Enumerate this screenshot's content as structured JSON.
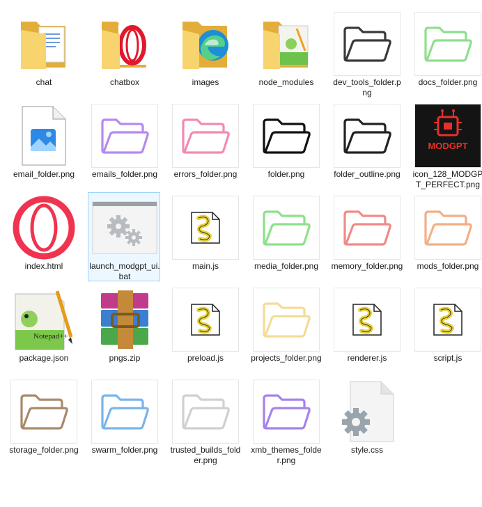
{
  "items": [
    {
      "label": "chat",
      "icon": "explorer-folder-document-icon",
      "kind": "folder-doc"
    },
    {
      "label": "chatbox",
      "icon": "explorer-folder-opera-icon",
      "kind": "folder-opera"
    },
    {
      "label": "images",
      "icon": "explorer-folder-edge-icon",
      "kind": "folder-edge"
    },
    {
      "label": "node_modules",
      "icon": "explorer-folder-notepadpp-icon",
      "kind": "folder-npp"
    },
    {
      "label": "dev_tools_folder.png",
      "icon": "folder-outline-icon",
      "kind": "png-folder",
      "color": "#3a3a3a"
    },
    {
      "label": "docs_folder.png",
      "icon": "folder-outline-icon",
      "kind": "png-folder",
      "color": "#8ee08a"
    },
    {
      "label": "email_folder.png",
      "icon": "image-file-icon",
      "kind": "image-file"
    },
    {
      "label": "emails_folder.png",
      "icon": "folder-outline-icon",
      "kind": "png-folder",
      "color": "#b48af0"
    },
    {
      "label": "errors_folder.png",
      "icon": "folder-outline-icon",
      "kind": "png-folder",
      "color": "#f28ab4"
    },
    {
      "label": "folder.png",
      "icon": "folder-outline-icon",
      "kind": "png-folder",
      "color": "#111111"
    },
    {
      "label": "folder_outline.png",
      "icon": "folder-outline-icon",
      "kind": "png-folder",
      "color": "#222222"
    },
    {
      "label": "icon_128_MODGPT_PERFECT.png",
      "icon": "modgpt-chip-icon",
      "kind": "modgpt",
      "text": "MODGPT"
    },
    {
      "label": "index.html",
      "icon": "opera-logo-icon",
      "kind": "opera"
    },
    {
      "label": "launch_modgpt_ui.bat",
      "icon": "batch-gears-icon",
      "kind": "bat",
      "selected": true
    },
    {
      "label": "main.js",
      "icon": "js-script-file-icon",
      "kind": "jsfile"
    },
    {
      "label": "media_folder.png",
      "icon": "folder-outline-icon",
      "kind": "png-folder",
      "color": "#8ee08a"
    },
    {
      "label": "memory_folder.png",
      "icon": "folder-outline-icon",
      "kind": "png-folder",
      "color": "#f08a88"
    },
    {
      "label": "mods_folder.png",
      "icon": "folder-outline-icon",
      "kind": "png-folder",
      "color": "#f4ae86"
    },
    {
      "label": "package.json",
      "icon": "notepadpp-file-icon",
      "kind": "npp"
    },
    {
      "label": "pngs.zip",
      "icon": "winrar-archive-icon",
      "kind": "zip"
    },
    {
      "label": "preload.js",
      "icon": "js-script-file-icon",
      "kind": "jsfile"
    },
    {
      "label": "projects_folder.png",
      "icon": "folder-outline-icon",
      "kind": "png-folder",
      "color": "#f4dc96"
    },
    {
      "label": "renderer.js",
      "icon": "js-script-file-icon",
      "kind": "jsfile"
    },
    {
      "label": "script.js",
      "icon": "js-script-file-icon",
      "kind": "jsfile"
    },
    {
      "label": "storage_folder.png",
      "icon": "folder-outline-icon",
      "kind": "png-folder",
      "color": "#a88a6a"
    },
    {
      "label": "swarm_folder.png",
      "icon": "folder-outline-icon",
      "kind": "png-folder",
      "color": "#7ab4ec"
    },
    {
      "label": "trusted_builds_folder.png",
      "icon": "folder-outline-icon",
      "kind": "png-folder",
      "color": "#d0d0d0"
    },
    {
      "label": "xmb_themes_folder.png",
      "icon": "folder-outline-icon",
      "kind": "png-folder",
      "color": "#a682ec"
    },
    {
      "label": "style.css",
      "icon": "css-settings-file-icon",
      "kind": "css"
    }
  ],
  "colors": {
    "selection_border": "#99d1ff",
    "explorer_folder": "#f2c94c"
  }
}
